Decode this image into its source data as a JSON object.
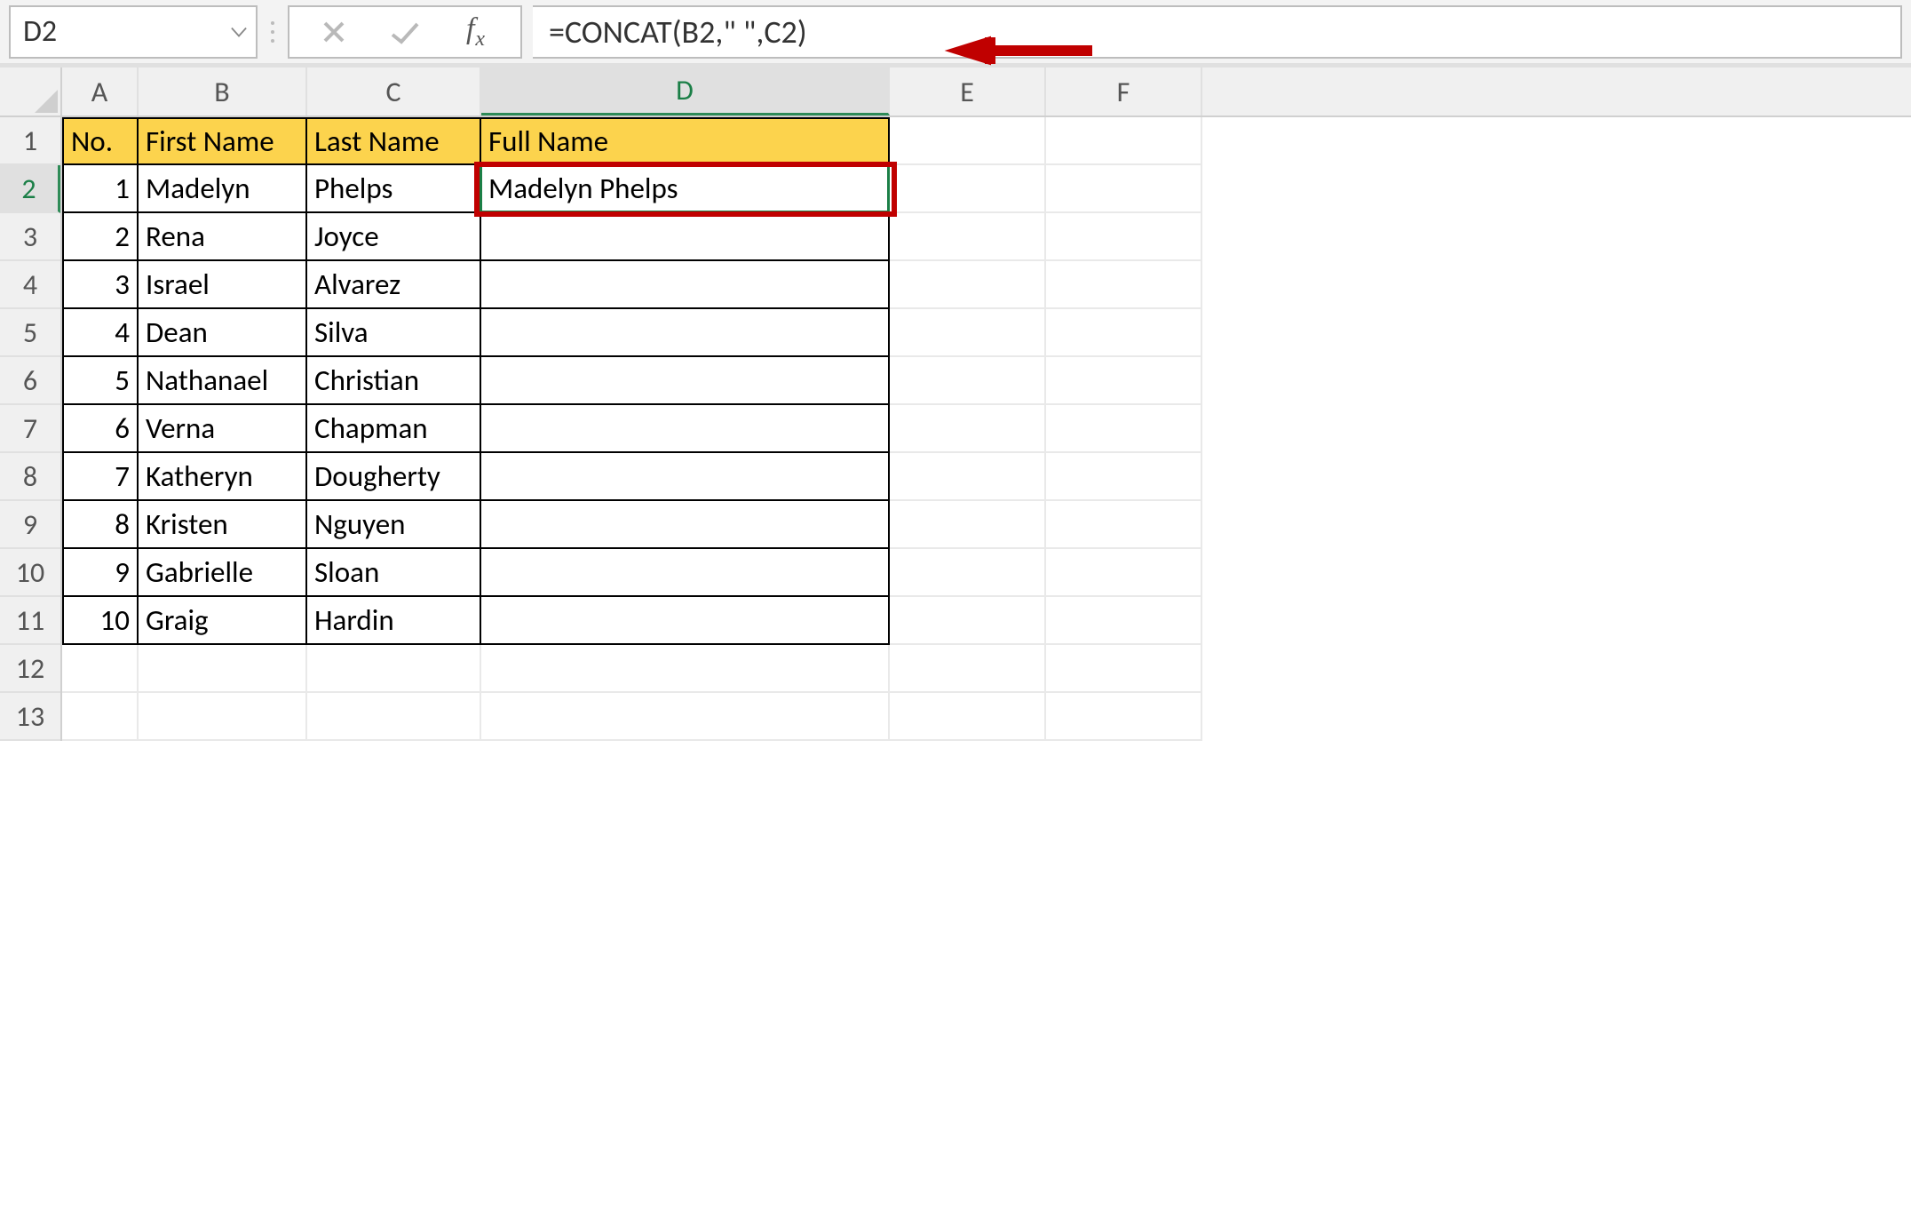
{
  "name_box": {
    "value": "D2"
  },
  "formula_bar": {
    "value": "=CONCAT(B2,\" \",C2)"
  },
  "columns": [
    "A",
    "B",
    "C",
    "D",
    "E",
    "F"
  ],
  "selected_column": "D",
  "selected_row": 2,
  "row_count": 13,
  "headers": {
    "A": "No.",
    "B": "First Name",
    "C": "Last Name",
    "D": "Full Name"
  },
  "rows": [
    {
      "no": "1",
      "first": "Madelyn",
      "last": "Phelps",
      "full": "Madelyn Phelps"
    },
    {
      "no": "2",
      "first": "Rena",
      "last": "Joyce",
      "full": ""
    },
    {
      "no": "3",
      "first": "Israel",
      "last": "Alvarez",
      "full": ""
    },
    {
      "no": "4",
      "first": "Dean",
      "last": "Silva",
      "full": ""
    },
    {
      "no": "5",
      "first": "Nathanael",
      "last": "Christian",
      "full": ""
    },
    {
      "no": "6",
      "first": "Verna",
      "last": "Chapman",
      "full": ""
    },
    {
      "no": "7",
      "first": "Katheryn",
      "last": "Dougherty",
      "full": ""
    },
    {
      "no": "8",
      "first": "Kristen",
      "last": "Nguyen",
      "full": ""
    },
    {
      "no": "9",
      "first": "Gabrielle",
      "last": "Sloan",
      "full": ""
    },
    {
      "no": "10",
      "first": "Graig",
      "last": "Hardin",
      "full": ""
    }
  ]
}
